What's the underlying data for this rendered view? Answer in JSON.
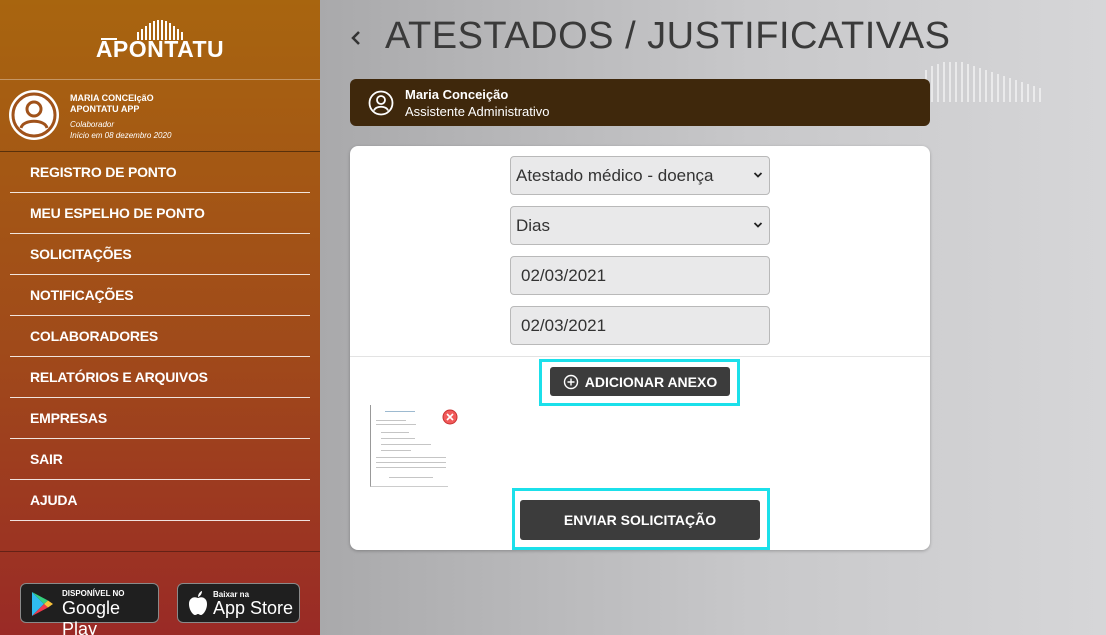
{
  "app": {
    "logo_text": "APONTATU"
  },
  "user": {
    "name": "MARIA CONCEIçãO",
    "company": "APONTATU APP",
    "role": "Colaborador",
    "since": "Início em 08 dezembro 2020"
  },
  "sidebar": {
    "items": [
      {
        "label": "REGISTRO DE PONTO"
      },
      {
        "label": "MEU ESPELHO DE PONTO"
      },
      {
        "label": "SOLICITAÇÕES"
      },
      {
        "label": "NOTIFICAÇÕES"
      },
      {
        "label": "COLABORADORES"
      },
      {
        "label": "RELATÓRIOS E ARQUIVOS"
      },
      {
        "label": "EMPRESAS"
      },
      {
        "label": "SAIR"
      },
      {
        "label": "AJUDA"
      }
    ]
  },
  "stores": {
    "google": {
      "small": "DISPONÍVEL NO",
      "big": "Google Play"
    },
    "apple": {
      "small": "Baixar na",
      "big": "App Store"
    }
  },
  "page": {
    "title": "ATESTADOS / JUSTIFICATIVAS"
  },
  "employee": {
    "name": "Maria Conceição",
    "role": "Assistente Administrativo"
  },
  "form": {
    "type_select": "Atestado médico - doença",
    "unit_select": "Dias",
    "start_date": "02/03/2021",
    "end_date": "02/03/2021",
    "add_attachment_label": "ADICIONAR ANEXO",
    "submit_label": "ENVIAR SOLICITAÇÃO"
  },
  "colors": {
    "highlight": "#1be0ea",
    "dark_button": "#3c3c3c",
    "employee_bar": "#3f280c",
    "sidebar_top": "#a8650f",
    "sidebar_bottom": "#9a2a26"
  },
  "icons": {
    "back": "chevron-left-icon",
    "avatar": "user-circle-icon",
    "add": "plus-circle-icon",
    "remove": "close-circle-icon",
    "google": "google-play-icon",
    "apple": "apple-icon"
  }
}
